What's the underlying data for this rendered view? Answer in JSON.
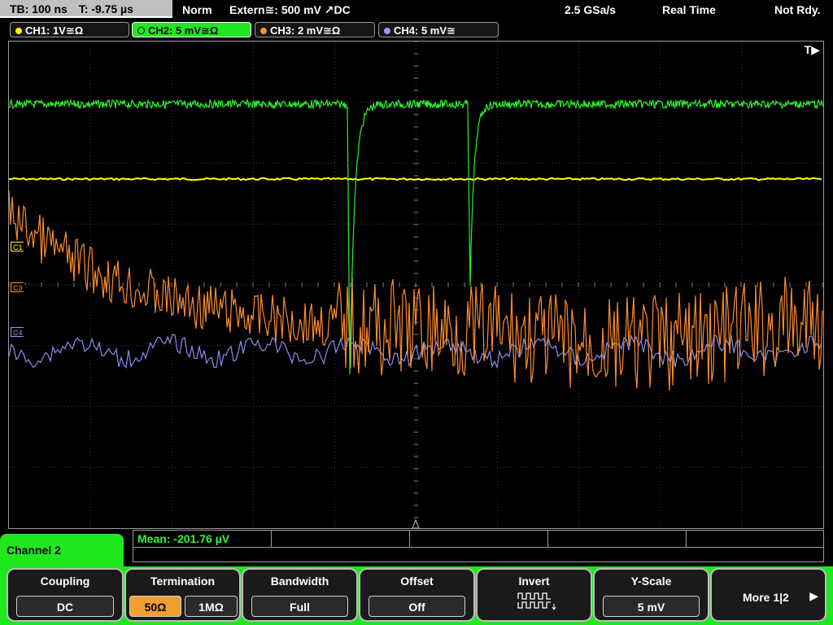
{
  "status": {
    "timebase": "TB: 100 ns",
    "trigger_time": "T: -9.75 µs",
    "mode": "Norm",
    "trigger_source": "Extern≅: 500 mV ↗DC",
    "sample_rate": "2.5 GSa/s",
    "acq_mode": "Real Time",
    "trigger_state": "Not Rdy."
  },
  "channels": [
    {
      "label": "CH1: 1V≅Ω",
      "color": "#ffff00"
    },
    {
      "label": "CH2: 5 mV≅Ω",
      "color": "#22e622"
    },
    {
      "label": "CH3: 2 mV≅Ω",
      "color": "#ff9030"
    },
    {
      "label": "CH4: 5 mV≅",
      "color": "#9a9aff"
    }
  ],
  "display": {
    "trigger_marker": "T▶",
    "markers": [
      "C1",
      "C3",
      "C4"
    ]
  },
  "measurement": {
    "mean": "Mean: -201.76 µV"
  },
  "menu": {
    "title": "Channel 2",
    "coupling": {
      "title": "Coupling",
      "value": "DC"
    },
    "termination": {
      "title": "Termination",
      "opt1": "50Ω",
      "opt2": "1MΩ"
    },
    "bandwidth": {
      "title": "Bandwidth",
      "value": "Full"
    },
    "offset": {
      "title": "Offset",
      "value": "Off"
    },
    "invert": {
      "title": "Invert"
    },
    "yscale": {
      "title": "Y-Scale",
      "value": "5 mV"
    },
    "more": {
      "label": "More 1|2"
    }
  }
}
